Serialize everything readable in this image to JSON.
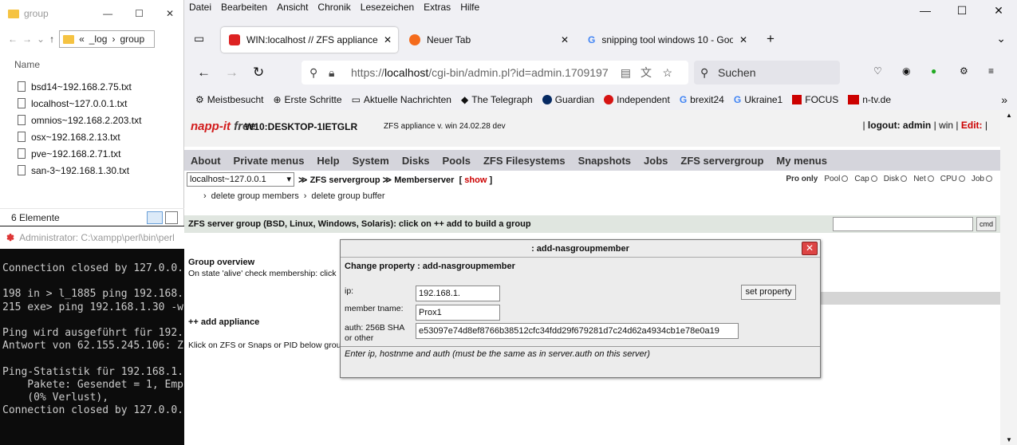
{
  "explorer": {
    "title": "group",
    "path": [
      "«",
      "_log",
      "›",
      "group"
    ],
    "column_header": "Name",
    "files": [
      "bsd14~192.168.2.75.txt",
      "localhost~127.0.0.1.txt",
      "omnios~192.168.2.203.txt",
      "osx~192.168.2.13.txt",
      "pve~192.168.2.71.txt",
      "san-3~192.168.1.30.txt"
    ],
    "status": "6 Elemente"
  },
  "cmd": {
    "title": "Administrator: C:\\xampp\\perl\\bin\\perl",
    "output": "Connection closed by 127.0.0.\n\n198 in > l_1885 ping 192.168.\n215 exe> ping 192.168.1.30 -w\n\nPing wird ausgeführt für 192.\nAntwort von 62.155.245.106: Z\n\nPing-Statistik für 192.168.1.\n    Pakete: Gesendet = 1, Emp\n    (0% Verlust),\nConnection closed by 127.0.0."
  },
  "browser": {
    "menu": [
      "Datei",
      "Bearbeiten",
      "Ansicht",
      "Chronik",
      "Lesezeichen",
      "Extras",
      "Hilfe"
    ],
    "tabs": [
      {
        "label": "WIN:localhost // ZFS appliance",
        "active": true
      },
      {
        "label": "Neuer Tab",
        "active": false
      },
      {
        "label": "snipping tool windows 10 - Goo",
        "active": false
      }
    ],
    "url_prefix": "https://",
    "url_host": "localhost",
    "url_rest": "/cgi-bin/admin.pl?id=admin.1709197",
    "search_placeholder": "Suchen",
    "bookmarks": [
      "Meistbesucht",
      "Erste Schritte",
      "Aktuelle Nachrichten",
      "The Telegraph",
      "Guardian",
      "Independent",
      "brexit24",
      "Ukraine1",
      "FOCUS",
      "n-tv.de"
    ]
  },
  "napp": {
    "logo_main": "napp-it",
    "logo_free": "free",
    "hostname": "W10:DESKTOP-1IETGLR",
    "version": "ZFS appliance v. win 24.02.28 dev",
    "logout_label": "logout:",
    "user": "admin",
    "win_label": "win",
    "edit_label": "Edit:",
    "nav": [
      "About",
      "Private menus",
      "Help",
      "System",
      "Disks",
      "Pools",
      "ZFS Filesystems",
      "Snapshots",
      "Jobs",
      "ZFS servergroup",
      "My menus"
    ],
    "host_select": "localhost~127.0.0.1",
    "crumb1": "≫ ZFS servergroup",
    "crumb2": "≫ Memberserver",
    "show_label": "show",
    "filters": [
      "Pro only",
      "Pool",
      "Cap",
      "Disk",
      "Net",
      "CPU",
      "Job"
    ],
    "subnav": [
      "delete group members",
      "delete group buffer"
    ],
    "group_bar": "ZFS server group (BSD, Linux, Windows, Solaris): click on ++ add to build a group",
    "cmd_button": "cmd",
    "overview_title": "Group overview",
    "overview_text": "On state 'alive' check membership: click",
    "add_appliance": "++ add appliance",
    "click_text": "Klick on ZFS or Snaps or PID below group"
  },
  "dialog": {
    "title": ": add-nasgroupmember",
    "subtitle": "Change property : add-nasgroupmember",
    "ip_label": "ip:",
    "ip_value": "192.168.1.",
    "tname_label": "member tname:",
    "tname_value": "Prox1",
    "auth_label": "auth: 256B SHA or other",
    "auth_value": "e53097e74d8ef8766b38512cfc34fdd29f679281d7c24d62a4934cb1e78e0a19",
    "set_button": "set property",
    "footer": "Enter ip, hostnme and auth (must be the same as in server.auth on this server)",
    "close": "✕"
  }
}
